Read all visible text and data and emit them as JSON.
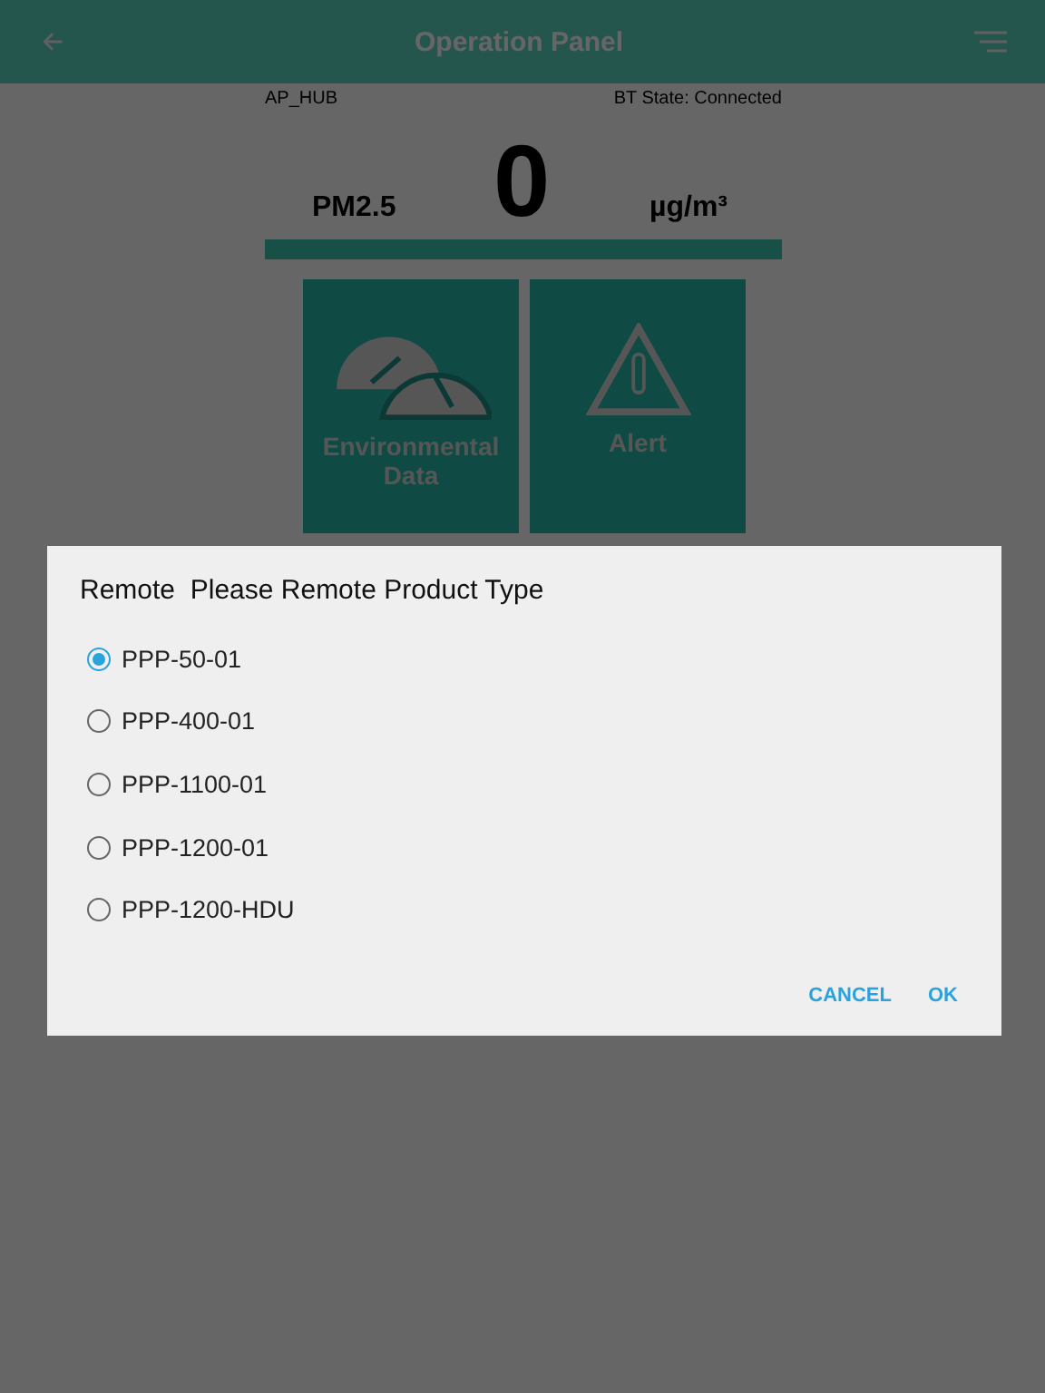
{
  "header": {
    "title": "Operation Panel"
  },
  "status": {
    "device": "AP_HUB",
    "bt_state": "BT State: Connected"
  },
  "reading": {
    "value": "0",
    "label": "PM2.5",
    "unit": "µg/m³"
  },
  "tiles": [
    {
      "kind": "gauges",
      "label": "Environmental Data"
    },
    {
      "kind": "alert",
      "label": "Alert"
    }
  ],
  "dialog": {
    "title": "Remote  Please Remote Product Type",
    "options": [
      {
        "label": "PPP-50-01",
        "selected": true
      },
      {
        "label": "PPP-400-01",
        "selected": false
      },
      {
        "label": "PPP-1100-01",
        "selected": false
      },
      {
        "label": "PPP-1200-01",
        "selected": false
      },
      {
        "label": "PPP-1200-HDU",
        "selected": false
      }
    ],
    "buttons": [
      "CANCEL",
      "OK"
    ]
  }
}
